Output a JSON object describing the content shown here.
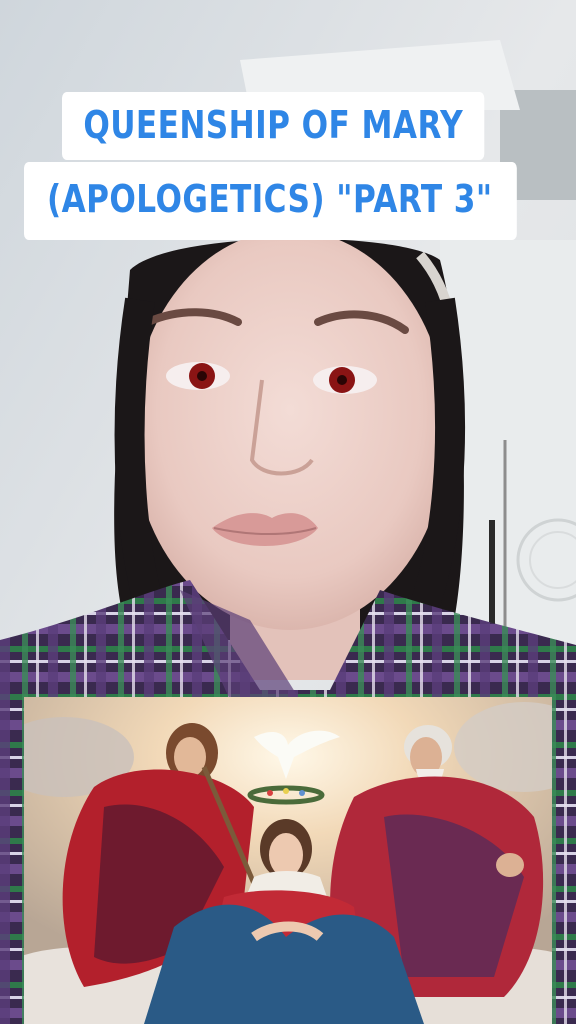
{
  "caption": {
    "line1": "QUEENSHIP OF MARY",
    "line2": "(APOLOGETICS) \"PART 3\""
  },
  "colors": {
    "caption_text": "#2f86e6",
    "caption_bg": "#ffffff"
  }
}
